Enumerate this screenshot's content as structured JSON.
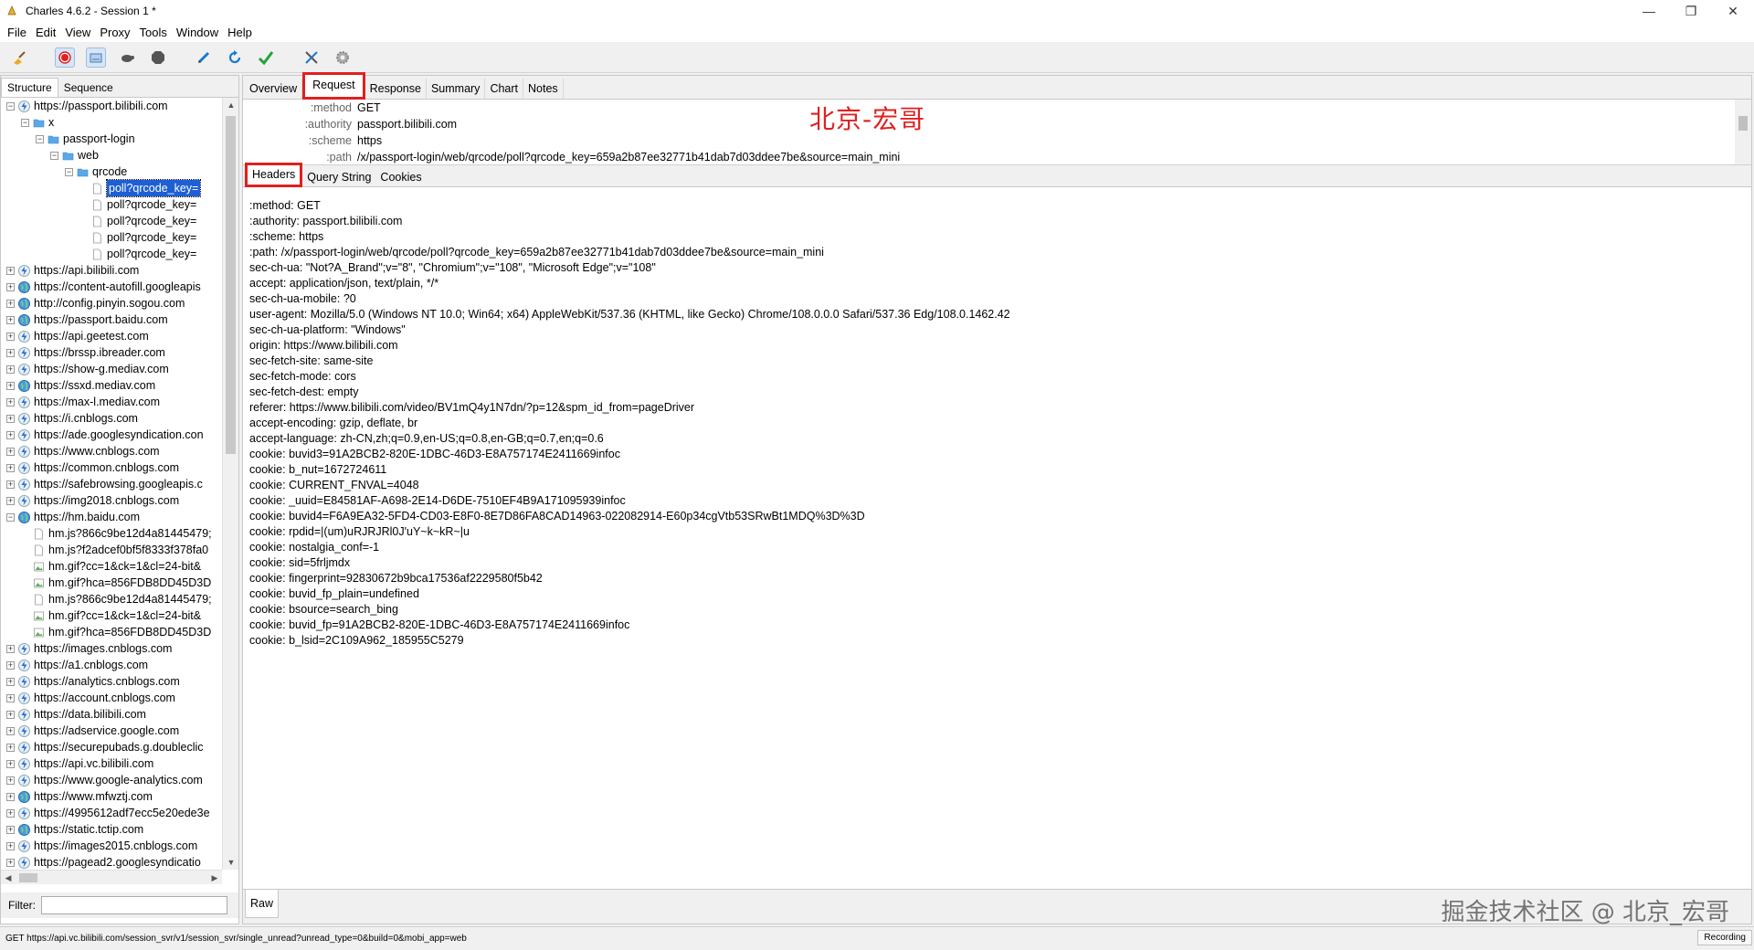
{
  "window": {
    "title": "Charles 4.6.2 - Session 1 *",
    "controls": [
      "—",
      "❐",
      "✕"
    ]
  },
  "menu": [
    "File",
    "Edit",
    "View",
    "Proxy",
    "Tools",
    "Window",
    "Help"
  ],
  "toolbar": {
    "colors": {
      "broom": "#e8b028",
      "record": "#e02020",
      "check": "#22a33a",
      "refresh": "#1a7ad0"
    }
  },
  "left_tabs": [
    "Structure",
    "Sequence"
  ],
  "tree": [
    {
      "label": "https://passport.bilibili.com",
      "depth": 0,
      "exp": "−",
      "icon": "bolt"
    },
    {
      "label": "x",
      "depth": 1,
      "exp": "−",
      "icon": "folder"
    },
    {
      "label": "passport-login",
      "depth": 2,
      "exp": "−",
      "icon": "folder"
    },
    {
      "label": "web",
      "depth": 3,
      "exp": "−",
      "icon": "folder"
    },
    {
      "label": "qrcode",
      "depth": 4,
      "exp": "−",
      "icon": "folder"
    },
    {
      "label": "poll?qrcode_key=",
      "depth": 5,
      "exp": "",
      "icon": "file",
      "selected": true
    },
    {
      "label": "poll?qrcode_key=",
      "depth": 5,
      "exp": "",
      "icon": "file"
    },
    {
      "label": "poll?qrcode_key=",
      "depth": 5,
      "exp": "",
      "icon": "file"
    },
    {
      "label": "poll?qrcode_key=",
      "depth": 5,
      "exp": "",
      "icon": "file"
    },
    {
      "label": "poll?qrcode_key=",
      "depth": 5,
      "exp": "",
      "icon": "file"
    },
    {
      "label": "https://api.bilibili.com",
      "depth": 0,
      "exp": "+",
      "icon": "bolt"
    },
    {
      "label": "https://content-autofill.googleapis",
      "depth": 0,
      "exp": "+",
      "icon": "globe"
    },
    {
      "label": "http://config.pinyin.sogou.com",
      "depth": 0,
      "exp": "+",
      "icon": "globe"
    },
    {
      "label": "https://passport.baidu.com",
      "depth": 0,
      "exp": "+",
      "icon": "globe"
    },
    {
      "label": "https://api.geetest.com",
      "depth": 0,
      "exp": "+",
      "icon": "bolt"
    },
    {
      "label": "https://brssp.ibreader.com",
      "depth": 0,
      "exp": "+",
      "icon": "bolt"
    },
    {
      "label": "https://show-g.mediav.com",
      "depth": 0,
      "exp": "+",
      "icon": "bolt"
    },
    {
      "label": "https://ssxd.mediav.com",
      "depth": 0,
      "exp": "+",
      "icon": "globe"
    },
    {
      "label": "https://max-l.mediav.com",
      "depth": 0,
      "exp": "+",
      "icon": "bolt"
    },
    {
      "label": "https://i.cnblogs.com",
      "depth": 0,
      "exp": "+",
      "icon": "bolt"
    },
    {
      "label": "https://ade.googlesyndication.con",
      "depth": 0,
      "exp": "+",
      "icon": "bolt"
    },
    {
      "label": "https://www.cnblogs.com",
      "depth": 0,
      "exp": "+",
      "icon": "bolt"
    },
    {
      "label": "https://common.cnblogs.com",
      "depth": 0,
      "exp": "+",
      "icon": "bolt"
    },
    {
      "label": "https://safebrowsing.googleapis.c",
      "depth": 0,
      "exp": "+",
      "icon": "bolt"
    },
    {
      "label": "https://img2018.cnblogs.com",
      "depth": 0,
      "exp": "+",
      "icon": "bolt"
    },
    {
      "label": "https://hm.baidu.com",
      "depth": 0,
      "exp": "−",
      "icon": "globe"
    },
    {
      "label": "hm.js?866c9be12d4a81445479;",
      "depth": 1,
      "exp": "",
      "icon": "file"
    },
    {
      "label": "hm.js?f2adcef0bf5f8333f378fa0",
      "depth": 1,
      "exp": "",
      "icon": "file"
    },
    {
      "label": "hm.gif?cc=1&ck=1&cl=24-bit&",
      "depth": 1,
      "exp": "",
      "icon": "image"
    },
    {
      "label": "hm.gif?hca=856FDB8DD45D3D",
      "depth": 1,
      "exp": "",
      "icon": "image"
    },
    {
      "label": "hm.js?866c9be12d4a81445479;",
      "depth": 1,
      "exp": "",
      "icon": "file"
    },
    {
      "label": "hm.gif?cc=1&ck=1&cl=24-bit&",
      "depth": 1,
      "exp": "",
      "icon": "image"
    },
    {
      "label": "hm.gif?hca=856FDB8DD45D3D",
      "depth": 1,
      "exp": "",
      "icon": "image"
    },
    {
      "label": "https://images.cnblogs.com",
      "depth": 0,
      "exp": "+",
      "icon": "bolt"
    },
    {
      "label": "https://a1.cnblogs.com",
      "depth": 0,
      "exp": "+",
      "icon": "bolt"
    },
    {
      "label": "https://analytics.cnblogs.com",
      "depth": 0,
      "exp": "+",
      "icon": "bolt"
    },
    {
      "label": "https://account.cnblogs.com",
      "depth": 0,
      "exp": "+",
      "icon": "bolt"
    },
    {
      "label": "https://data.bilibili.com",
      "depth": 0,
      "exp": "+",
      "icon": "bolt"
    },
    {
      "label": "https://adservice.google.com",
      "depth": 0,
      "exp": "+",
      "icon": "bolt"
    },
    {
      "label": "https://securepubads.g.doubleclic",
      "depth": 0,
      "exp": "+",
      "icon": "bolt"
    },
    {
      "label": "https://api.vc.bilibili.com",
      "depth": 0,
      "exp": "+",
      "icon": "bolt"
    },
    {
      "label": "https://www.google-analytics.com",
      "depth": 0,
      "exp": "+",
      "icon": "bolt"
    },
    {
      "label": "https://www.mfwztj.com",
      "depth": 0,
      "exp": "+",
      "icon": "globe"
    },
    {
      "label": "https://4995612adf7ecc5e20ede3e",
      "depth": 0,
      "exp": "+",
      "icon": "bolt"
    },
    {
      "label": "https://static.tctip.com",
      "depth": 0,
      "exp": "+",
      "icon": "globe"
    },
    {
      "label": "https://images2015.cnblogs.com",
      "depth": 0,
      "exp": "+",
      "icon": "bolt"
    },
    {
      "label": "https://pagead2.googlesyndicatio",
      "depth": 0,
      "exp": "+",
      "icon": "bolt"
    }
  ],
  "filter": {
    "label": "Filter:",
    "value": ""
  },
  "right_tabs": [
    "Overview",
    "Request",
    "Response",
    "Summary",
    "Chart",
    "Notes"
  ],
  "active_right_tab": "Request",
  "summary_rows": [
    {
      "key": ":method",
      "value": "GET"
    },
    {
      "key": ":authority",
      "value": "passport.bilibili.com"
    },
    {
      "key": ":scheme",
      "value": "https"
    },
    {
      "key": ":path",
      "value": "/x/passport-login/web/qrcode/poll?qrcode_key=659a2b87ee32771b41dab7d03ddee7be&source=main_mini"
    }
  ],
  "watermark_top": "北京-宏哥",
  "sub_tabs": [
    "Headers",
    "Query String",
    "Cookies"
  ],
  "active_sub_tab": "Headers",
  "header_lines": [
    ":method: GET",
    ":authority: passport.bilibili.com",
    ":scheme: https",
    ":path: /x/passport-login/web/qrcode/poll?qrcode_key=659a2b87ee32771b41dab7d03ddee7be&source=main_mini",
    "sec-ch-ua: \"Not?A_Brand\";v=\"8\", \"Chromium\";v=\"108\", \"Microsoft Edge\";v=\"108\"",
    "accept: application/json, text/plain, */*",
    "sec-ch-ua-mobile: ?0",
    "user-agent: Mozilla/5.0 (Windows NT 10.0; Win64; x64) AppleWebKit/537.36 (KHTML, like Gecko) Chrome/108.0.0.0 Safari/537.36 Edg/108.0.1462.42",
    "sec-ch-ua-platform: \"Windows\"",
    "origin: https://www.bilibili.com",
    "sec-fetch-site: same-site",
    "sec-fetch-mode: cors",
    "sec-fetch-dest: empty",
    "referer: https://www.bilibili.com/video/BV1mQ4y1N7dn/?p=12&spm_id_from=pageDriver",
    "accept-encoding: gzip, deflate, br",
    "accept-language: zh-CN,zh;q=0.9,en-US;q=0.8,en-GB;q=0.7,en;q=0.6",
    "cookie: buvid3=91A2BCB2-820E-1DBC-46D3-E8A757174E2411669infoc",
    "cookie: b_nut=1672724611",
    "cookie: CURRENT_FNVAL=4048",
    "cookie: _uuid=E84581AF-A698-2E14-D6DE-7510EF4B9A171095939infoc",
    "cookie: buvid4=F6A9EA32-5FD4-CD03-E8F0-8E7D86FA8CAD14963-022082914-E60p34cgVtb53SRwBt1MDQ%3D%3D",
    "cookie: rpdid=|(um)uRJRJRl0J'uY~k~kR~|u",
    "cookie: nostalgia_conf=-1",
    "cookie: sid=5frljmdx",
    "cookie: fingerprint=92830672b9bca17536af2229580f5b42",
    "cookie: buvid_fp_plain=undefined",
    "cookie: bsource=search_bing",
    "cookie: buvid_fp=91A2BCB2-820E-1DBC-46D3-E8A757174E2411669infoc",
    "cookie: b_lsid=2C109A962_185955C5279"
  ],
  "bottom_tab": "Raw",
  "watermark_bottom": "掘金技术社区 @ 北京_宏哥",
  "status": {
    "text": "GET https://api.vc.bilibili.com/session_svr/v1/session_svr/single_unread?unread_type=0&build=0&mobi_app=web",
    "recording": "Recording"
  }
}
